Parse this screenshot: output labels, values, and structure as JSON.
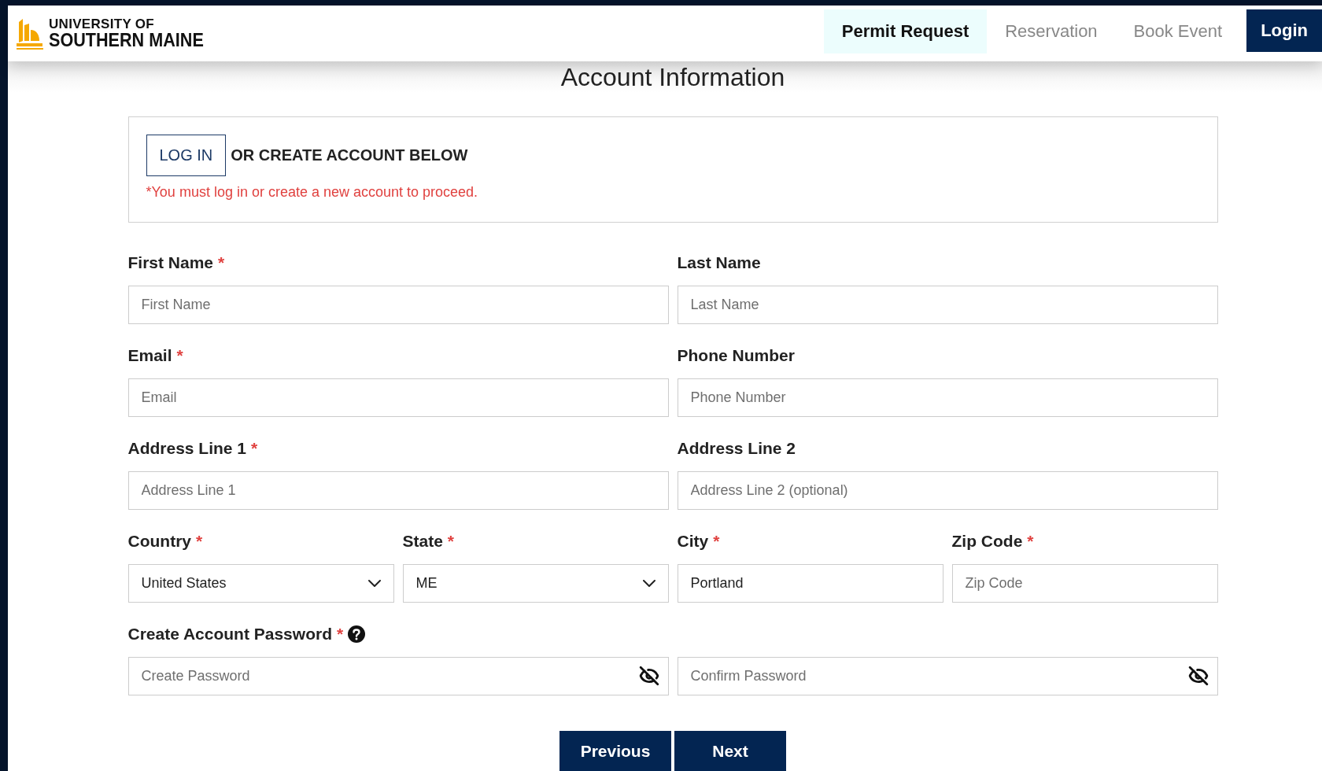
{
  "header": {
    "logo": {
      "line1": "UNIVERSITY OF",
      "line2": "SOUTHERN MAINE"
    },
    "nav": [
      {
        "label": "Permit Request",
        "selected": true
      },
      {
        "label": "Reservation",
        "selected": false
      },
      {
        "label": "Book Event",
        "selected": false
      }
    ],
    "login_button": "Login"
  },
  "title": "Account Information",
  "login_card": {
    "button": "LOG IN",
    "text": "OR CREATE ACCOUNT BELOW",
    "warning": "*You must log in or create a new account to proceed."
  },
  "rows": [
    {
      "fields": [
        {
          "kind": "text",
          "label": "First Name",
          "required_mark": "*",
          "placeholder": "First Name"
        },
        {
          "kind": "text",
          "label": "Last Name",
          "placeholder": "Last Name"
        }
      ]
    },
    {
      "fields": [
        {
          "kind": "text",
          "label": "Email",
          "required_mark": "*",
          "placeholder": "Email"
        },
        {
          "kind": "text",
          "label": "Phone Number",
          "placeholder": "Phone Number"
        }
      ]
    },
    {
      "fields": [
        {
          "kind": "text",
          "label": "Address Line 1",
          "required_mark": "*",
          "placeholder": "Address Line 1"
        },
        {
          "kind": "text",
          "label": "Address Line 2",
          "placeholder": "Address Line 2 (optional)"
        }
      ]
    },
    {
      "fields": [
        {
          "kind": "select",
          "label": "Country",
          "required_mark": "*",
          "value": "United States"
        },
        {
          "kind": "select",
          "label": "State",
          "required_mark": "*",
          "value": "ME"
        },
        {
          "kind": "text",
          "label": "City",
          "required_mark": "*",
          "value": "Portland"
        },
        {
          "kind": "text",
          "label": "Zip Code",
          "required_mark": "*",
          "placeholder": "Zip Code"
        }
      ]
    },
    {
      "fields": [
        {
          "kind": "password",
          "label": "Create Account Password",
          "required_mark": "*",
          "help_icon": true,
          "placeholder": "Create Password"
        },
        {
          "kind": "password",
          "placeholder": "Confirm Password"
        }
      ]
    }
  ],
  "buttons": [
    "Previous",
    "Next"
  ]
}
